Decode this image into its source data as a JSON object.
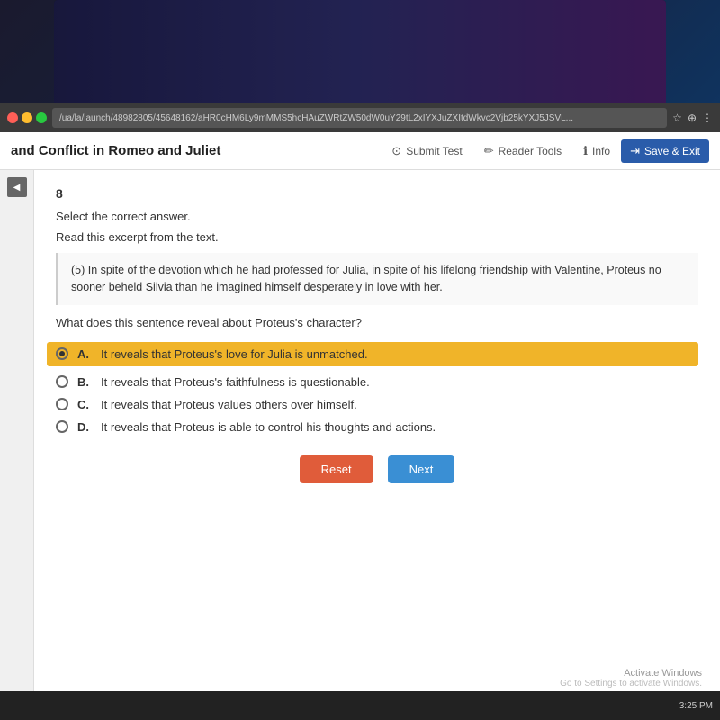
{
  "desktop": {
    "background": "dark gradient"
  },
  "browser": {
    "address": "/ua/la/launch/48982805/45648162/aHR0cHM6Ly9mMMS5hcHAuZWRtZW50dW0uY29tL2xIYXJuZXItdWkvc2Vjb25kYXJ5JSVL...",
    "window_controls": {
      "close": "×",
      "minimize": "−",
      "maximize": "□"
    }
  },
  "toolbar": {
    "title": "and Conflict in Romeo and Juliet",
    "submit_label": "Submit Test",
    "reader_tools_label": "Reader Tools",
    "info_label": "Info",
    "save_exit_label": "Save & Exit"
  },
  "question": {
    "number": "8",
    "instruction": "Select the correct answer.",
    "read_instruction": "Read this excerpt from the text.",
    "excerpt": "(5) In spite of the devotion which he had professed for Julia, in spite of his lifelong friendship with Valentine, Proteus no sooner beheld Silvia than he imagined himself desperately in love with her.",
    "question_text": "What does this sentence reveal about Proteus's character?",
    "choices": [
      {
        "letter": "A.",
        "text": "It reveals that Proteus's love for Julia is unmatched.",
        "selected": true
      },
      {
        "letter": "B.",
        "text": "It reveals that Proteus's faithfulness is questionable.",
        "selected": false
      },
      {
        "letter": "C.",
        "text": "It reveals that Proteus values others over himself.",
        "selected": false
      },
      {
        "letter": "D.",
        "text": "It reveals that Proteus is able to control his thoughts and actions.",
        "selected": false
      }
    ],
    "reset_label": "Reset",
    "next_label": "Next"
  },
  "watermark": {
    "title": "Activate Windows",
    "subtitle": "Go to Settings to activate Windows."
  },
  "taskbar": {
    "time": "3:25 PM"
  }
}
